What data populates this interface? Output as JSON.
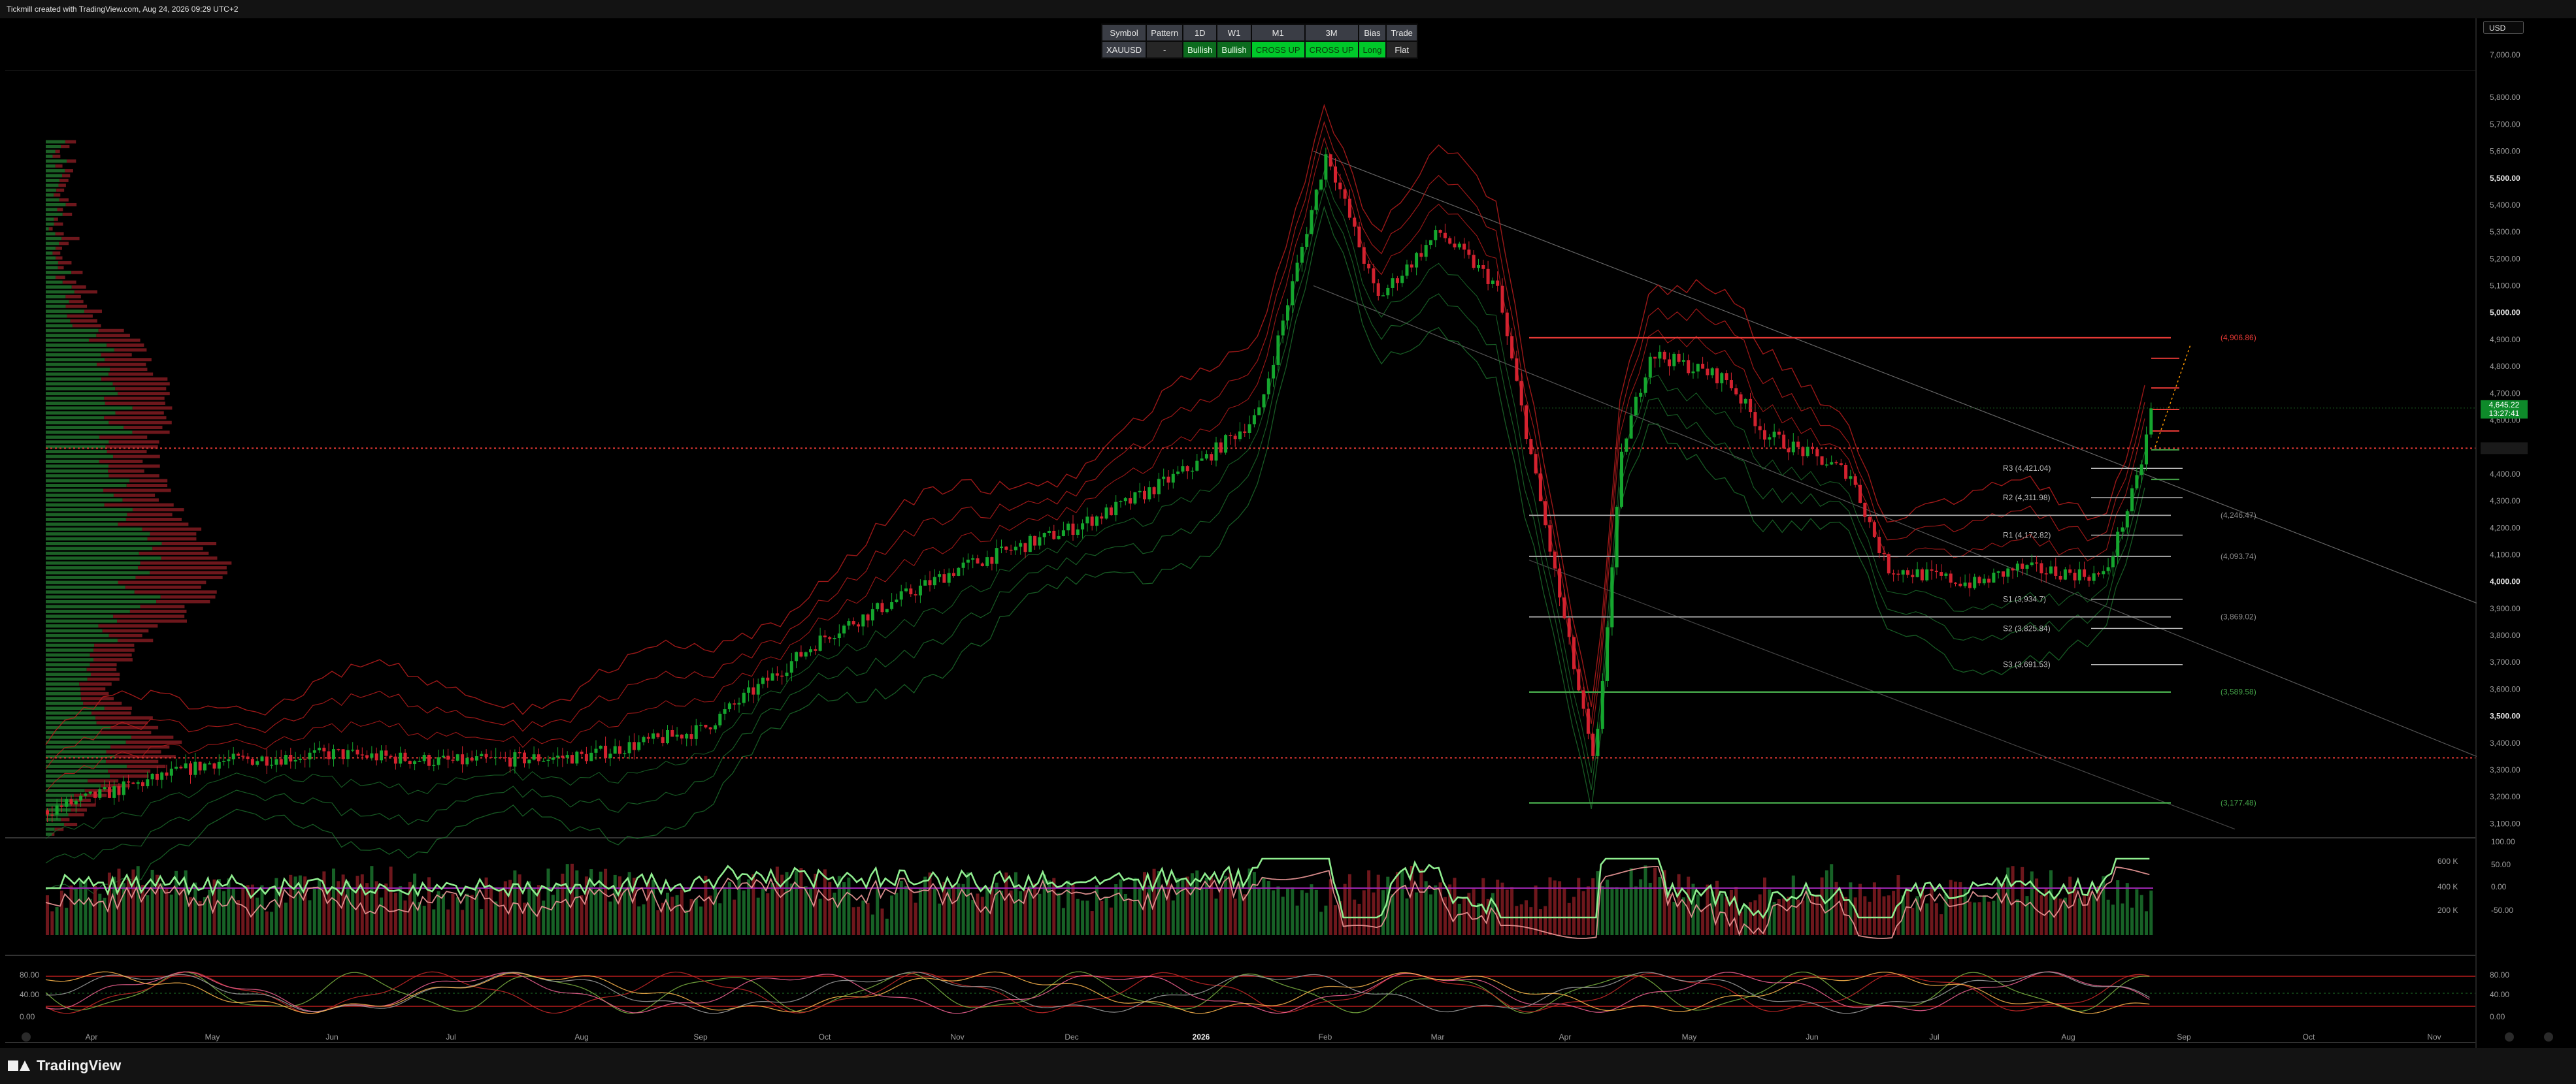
{
  "header": {
    "title": "Tickmill created with TradingView.com, Aug 24, 2026 09:29 UTC+2"
  },
  "footer": {
    "brand": "TradingView"
  },
  "currency": "USD",
  "signal_table": {
    "headers": [
      "Symbol",
      "Pattern",
      "1D",
      "W1",
      "M1",
      "3M",
      "Bias",
      "Trade"
    ],
    "row": [
      "XAUUSD",
      "-",
      "Bullish",
      "Bullish",
      "CROSS UP",
      "CROSS UP",
      "Long",
      "Flat"
    ]
  },
  "colors": {
    "bull": "#15a62e",
    "bear": "#d3222f",
    "band": "#b71c1c",
    "band_green": "#1b6b2a",
    "ref_line": "#e53935",
    "rsi": "#90ee90"
  },
  "chart_data": [
    {
      "type": "candlestick",
      "symbol": "XAUUSD",
      "x_labels": [
        "Apr",
        "May",
        "Jun",
        "Jul",
        "Aug",
        "Sep",
        "Oct",
        "Nov",
        "Dec",
        "2026",
        "Feb",
        "Mar",
        "Apr",
        "May",
        "Jun",
        "Jul",
        "Aug",
        "Sep",
        "Oct",
        "Nov"
      ],
      "y_ticks": [
        3100,
        3200,
        3300,
        3400,
        3500,
        3600,
        3700,
        3800,
        3900,
        4000,
        4100,
        4200,
        4300,
        4400,
        4500,
        4600,
        4700,
        4800,
        4900,
        5000,
        5100,
        5200,
        5300,
        5400,
        5500,
        5600,
        5700,
        5800,
        7000
      ],
      "y_tick_labels": [
        "3,100.00",
        "3,200.00",
        "3,300.00",
        "3,400.00",
        "3,500.00",
        "3,600.00",
        "3,700.00",
        "3,800.00",
        "3,900.00",
        "4,000.00",
        "4,100.00",
        "4,200.00",
        "4,300.00",
        "4,400.00",
        "4,500.00",
        "4,600.00",
        "4,700.00",
        "4,800.00",
        "4,900.00",
        "5,000.00",
        "5,100.00",
        "5,200.00",
        "5,300.00",
        "5,400.00",
        "5,500.00",
        "5,600.00",
        "5,700.00",
        "5,800.00",
        "7,000.00"
      ],
      "ylim": [
        3050,
        5900
      ],
      "close_path_points": [
        [
          "Apr",
          3150
        ],
        [
          "Apr",
          3300
        ],
        [
          "May",
          3330
        ],
        [
          "Jun",
          3360
        ],
        [
          "Jul",
          3330
        ],
        [
          "Aug",
          3350
        ],
        [
          "Sep",
          3450
        ],
        [
          "Sep",
          3600
        ],
        [
          "Oct",
          3800
        ],
        [
          "Oct",
          3980
        ],
        [
          "Nov",
          4050
        ],
        [
          "Nov",
          4020
        ],
        [
          "Dec",
          4200
        ],
        [
          "Dec",
          4300
        ],
        [
          "2026",
          4450
        ],
        [
          "2026",
          4620
        ],
        [
          "Feb",
          5600
        ],
        [
          "Feb",
          5050
        ],
        [
          "Mar",
          5300
        ],
        [
          "Mar",
          5100
        ],
        [
          "Apr",
          4500
        ],
        [
          "Apr",
          4850
        ],
        [
          "May",
          4750
        ],
        [
          "May",
          4550
        ],
        [
          "Jun",
          4400
        ],
        [
          "Jun",
          4050
        ],
        [
          "Jul",
          3990
        ],
        [
          "Jul",
          4050
        ],
        [
          "Aug",
          4020
        ],
        [
          "Aug",
          4400
        ],
        [
          "Sep",
          4645
        ]
      ],
      "current_price_label": "4,645.22",
      "countdown_label": "13:27:41",
      "dotted_levels": [
        4496,
        3345
      ],
      "levels": [
        {
          "label": "(4,906.86)",
          "value": 4906.86,
          "color": "#e53935"
        },
        {
          "label": "R3 (4,421.04)",
          "value": 4421.04
        },
        {
          "label": "R2 (4,311.98)",
          "value": 4311.98
        },
        {
          "label": "(4,246.47)",
          "value": 4246.47
        },
        {
          "label": "R1 (4,172.82)",
          "value": 4172.82
        },
        {
          "label": "(4,093.74)",
          "value": 4093.74
        },
        {
          "label": "S1 (3,934.7)",
          "value": 3934.7
        },
        {
          "label": "(3,869.02)",
          "value": 3869.02
        },
        {
          "label": "S2 (3,825.84)",
          "value": 3825.84
        },
        {
          "label": "S3 (3,691.53)",
          "value": 3691.53
        },
        {
          "label": "(3,589.58)",
          "value": 3589.58,
          "color": "#43a047"
        },
        {
          "label": "(3,177.48)",
          "value": 3177.48,
          "color": "#43a047"
        }
      ]
    },
    {
      "type": "line",
      "name": "RSI / volume pane",
      "y_tick_labels": [
        "100.00",
        "50.00",
        "0.00",
        "-50.00"
      ],
      "volume_tick_labels": [
        "600 K",
        "400 K",
        "200 K"
      ]
    },
    {
      "type": "line",
      "name": "Stochastic pane",
      "y_tick_labels": [
        "80.00",
        "40.00",
        "0.00"
      ],
      "right_tick_labels": [
        "80.00",
        "40.00",
        "0.00"
      ]
    }
  ]
}
